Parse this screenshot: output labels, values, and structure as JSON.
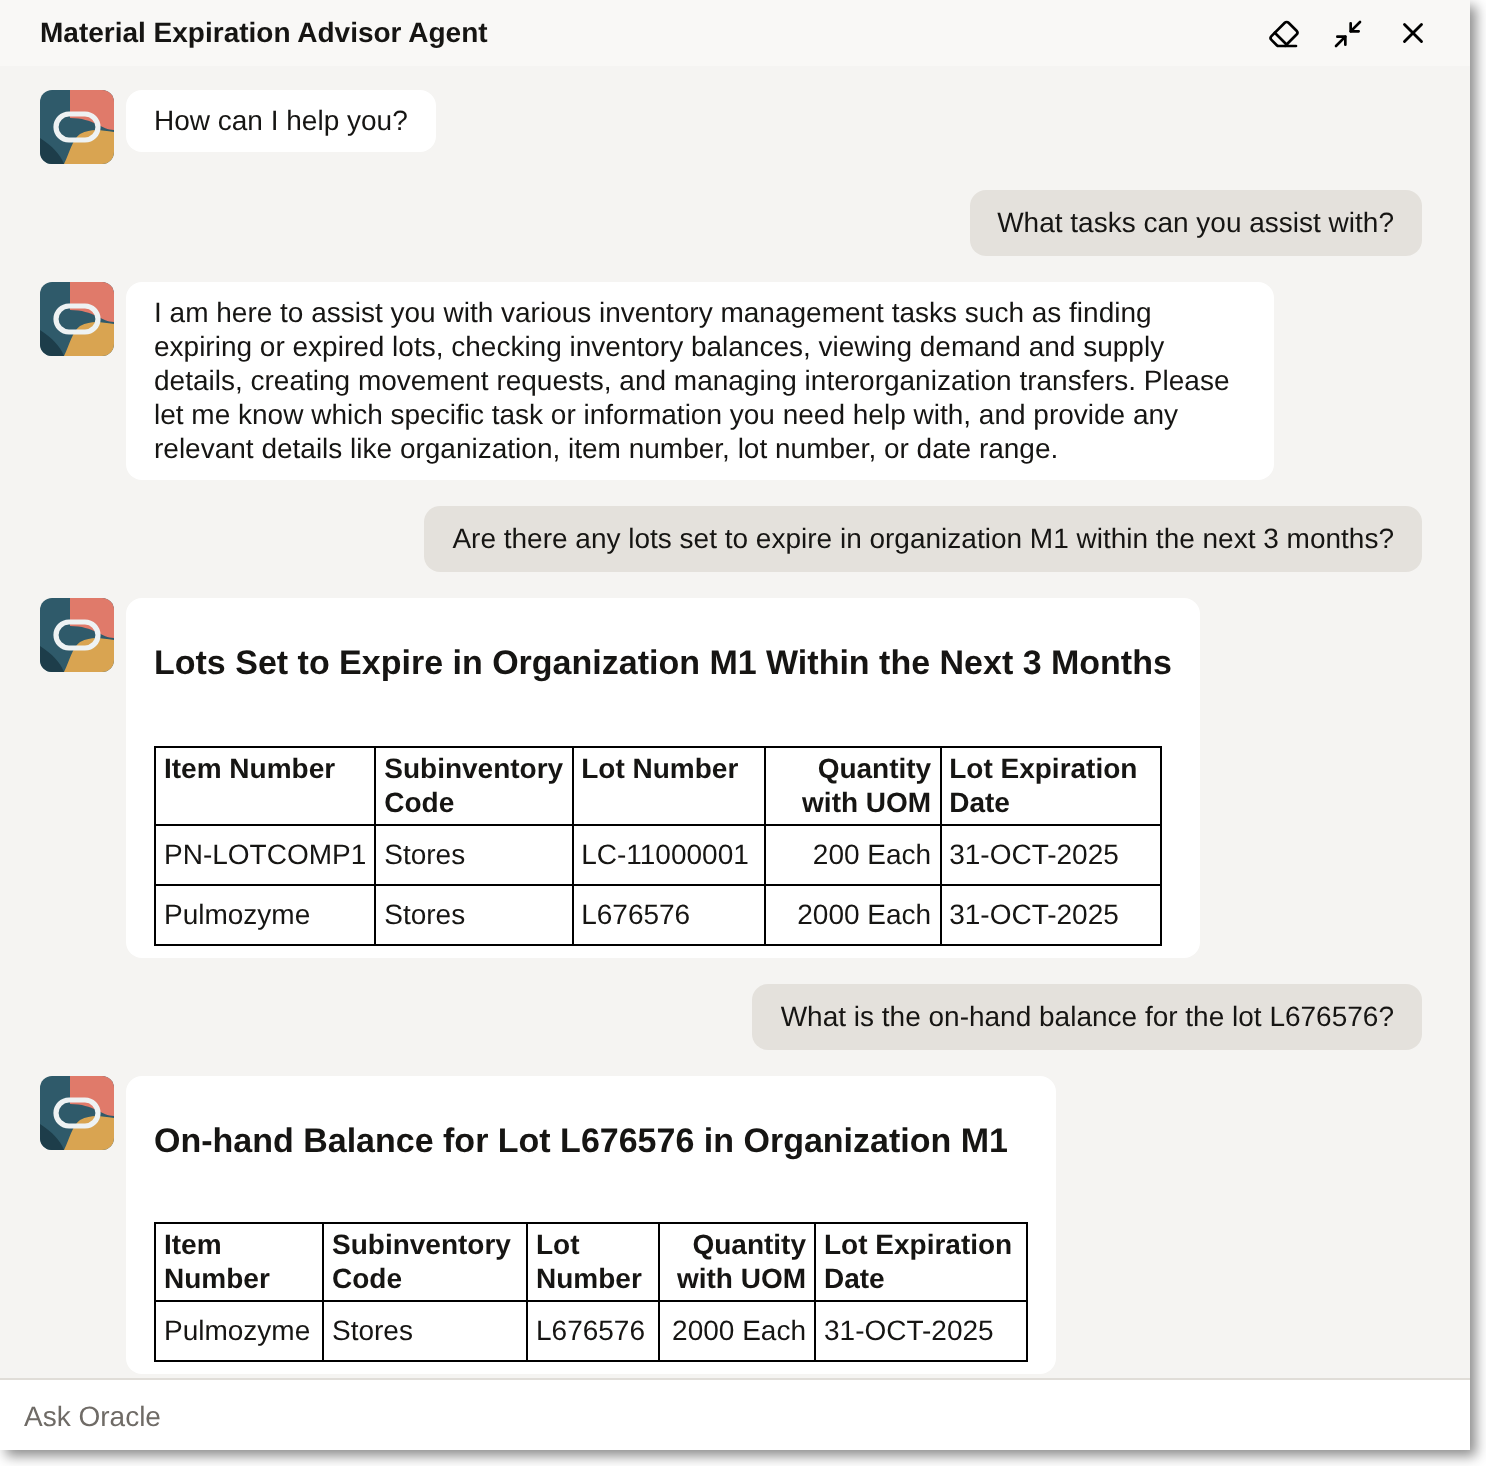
{
  "window": {
    "title": "Material Expiration Advisor Agent"
  },
  "messages": [
    {
      "kind": "agent_text",
      "text": "How can I help you?"
    },
    {
      "kind": "user_text",
      "text": "What tasks can you assist with?"
    },
    {
      "kind": "agent_text",
      "text": "I am here to assist you with various inventory management tasks such as finding expiring or expired lots, checking inventory balances, viewing demand and supply details, creating movement requests, and managing interorganization transfers. Please let me know which specific task or information you need help with, and provide any relevant details like organization, item number, lot number, or date range."
    },
    {
      "kind": "user_text",
      "text": "Are there any lots set to expire in organization M1 within the next 3 months?"
    },
    {
      "kind": "agent_table",
      "title": "Lots Set to Expire in Organization M1 Within the Next 3 Months",
      "columns": [
        "Item Number",
        "Subinventory Code",
        "Lot Number",
        "Quantity with UOM",
        "Lot Expiration Date"
      ],
      "rows": [
        [
          "PN-LOTCOMP1",
          "Stores",
          "LC-11000001",
          "200 Each",
          "31-OCT-2025"
        ],
        [
          "Pulmozyme",
          "Stores",
          "L676576",
          "2000 Each",
          "31-OCT-2025"
        ]
      ]
    },
    {
      "kind": "user_text",
      "text": "What is the on-hand balance for the lot L676576?"
    },
    {
      "kind": "agent_table",
      "title": "On-hand Balance for Lot L676576 in Organization M1",
      "columns": [
        "Item Number",
        "Subinventory Code",
        "Lot Number",
        "Quantity with UOM",
        "Lot Expiration Date"
      ],
      "rows": [
        [
          "Pulmozyme",
          "Stores",
          "L676576",
          "2000 Each",
          "31-OCT-2025"
        ]
      ]
    }
  ],
  "input": {
    "placeholder": "Ask Oracle"
  }
}
